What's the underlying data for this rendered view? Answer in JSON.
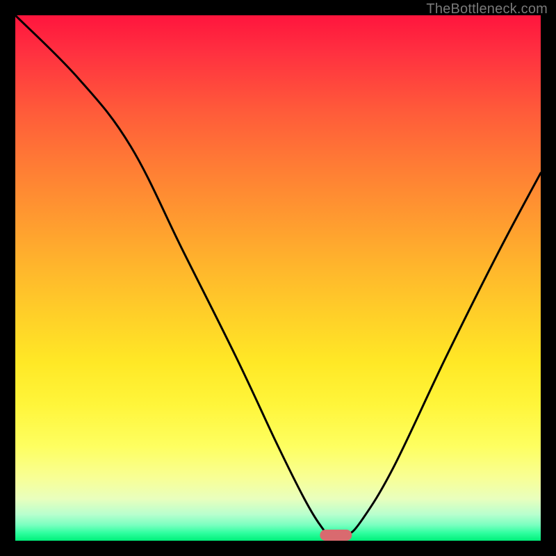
{
  "attribution": "TheBottleneck.com",
  "chart_data": {
    "type": "line",
    "title": "",
    "xlabel": "",
    "ylabel": "",
    "xlim": [
      0,
      100
    ],
    "ylim": [
      0,
      100
    ],
    "series": [
      {
        "name": "curve",
        "x": [
          0,
          12,
          22,
          32,
          42,
          50,
          55,
          58,
          60,
          63,
          66,
          72,
          82,
          92,
          100
        ],
        "values": [
          100,
          88,
          75,
          55,
          35,
          18,
          8,
          3,
          1,
          1,
          4,
          14,
          35,
          55,
          70
        ]
      }
    ],
    "marker": {
      "x_range": [
        58,
        64
      ],
      "y": 1
    },
    "background_gradient": {
      "stops": [
        {
          "pos": 0,
          "color": "#ff153d"
        },
        {
          "pos": 50,
          "color": "#ffd228"
        },
        {
          "pos": 85,
          "color": "#feff60"
        },
        {
          "pos": 100,
          "color": "#00f07a"
        }
      ]
    }
  }
}
